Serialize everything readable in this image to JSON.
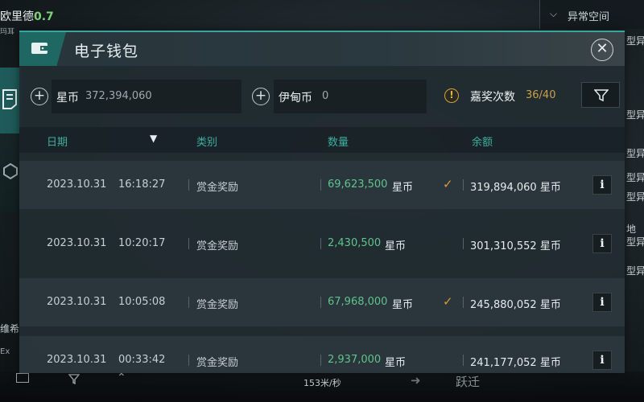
{
  "background": {
    "character_name": "欧里德",
    "character_level": "0.7",
    "character_sub": "玛耳",
    "top_right_chevron": "chevron-down",
    "top_right_label": "异常空间",
    "right_list": [
      "型异",
      "型异",
      "型异",
      "型异",
      "型异",
      "地",
      "型异",
      "型异"
    ],
    "side_left_text": "维希",
    "side_left_text2": "Ex",
    "bottom_speed": "153米/秒",
    "bottom_jump": "跃迁"
  },
  "wallet": {
    "title": "电子钱包",
    "close_icon": "close-icon",
    "currencies": [
      {
        "name": "星币",
        "value": "372,394,060"
      },
      {
        "name": "伊甸币",
        "value": "0"
      }
    ],
    "bounty": {
      "label": "嘉奖次数",
      "value": "36/40"
    },
    "columns": {
      "date": "日期",
      "type": "类别",
      "amount": "数量",
      "balance": "余额"
    },
    "rows": [
      {
        "date": "2023.10.31",
        "time": "16:18:27",
        "type": "赏金奖励",
        "amount": "69,623,500",
        "unit": "星币",
        "checked": true,
        "balance": "319,894,060 星币",
        "info": "i"
      },
      {
        "date": "2023.10.31",
        "time": "10:20:17",
        "type": "赏金奖励",
        "amount": "2,430,500",
        "unit": "星币",
        "checked": false,
        "balance": "301,310,552 星币",
        "info": "i"
      },
      {
        "date": "2023.10.31",
        "time": "10:05:08",
        "type": "赏金奖励",
        "amount": "67,968,000",
        "unit": "星币",
        "checked": true,
        "balance": "245,880,052 星币",
        "info": "i"
      },
      {
        "date": "2023.10.31",
        "time": "00:33:42",
        "type": "赏金奖励",
        "amount": "2,937,000",
        "unit": "星币",
        "checked": false,
        "balance": "241,177,052 星币",
        "info": "i"
      }
    ],
    "check_glyph": "✓",
    "colors": {
      "accent": "#3aa59a",
      "amount": "#5fc48c",
      "warning": "#d9a23a"
    }
  }
}
